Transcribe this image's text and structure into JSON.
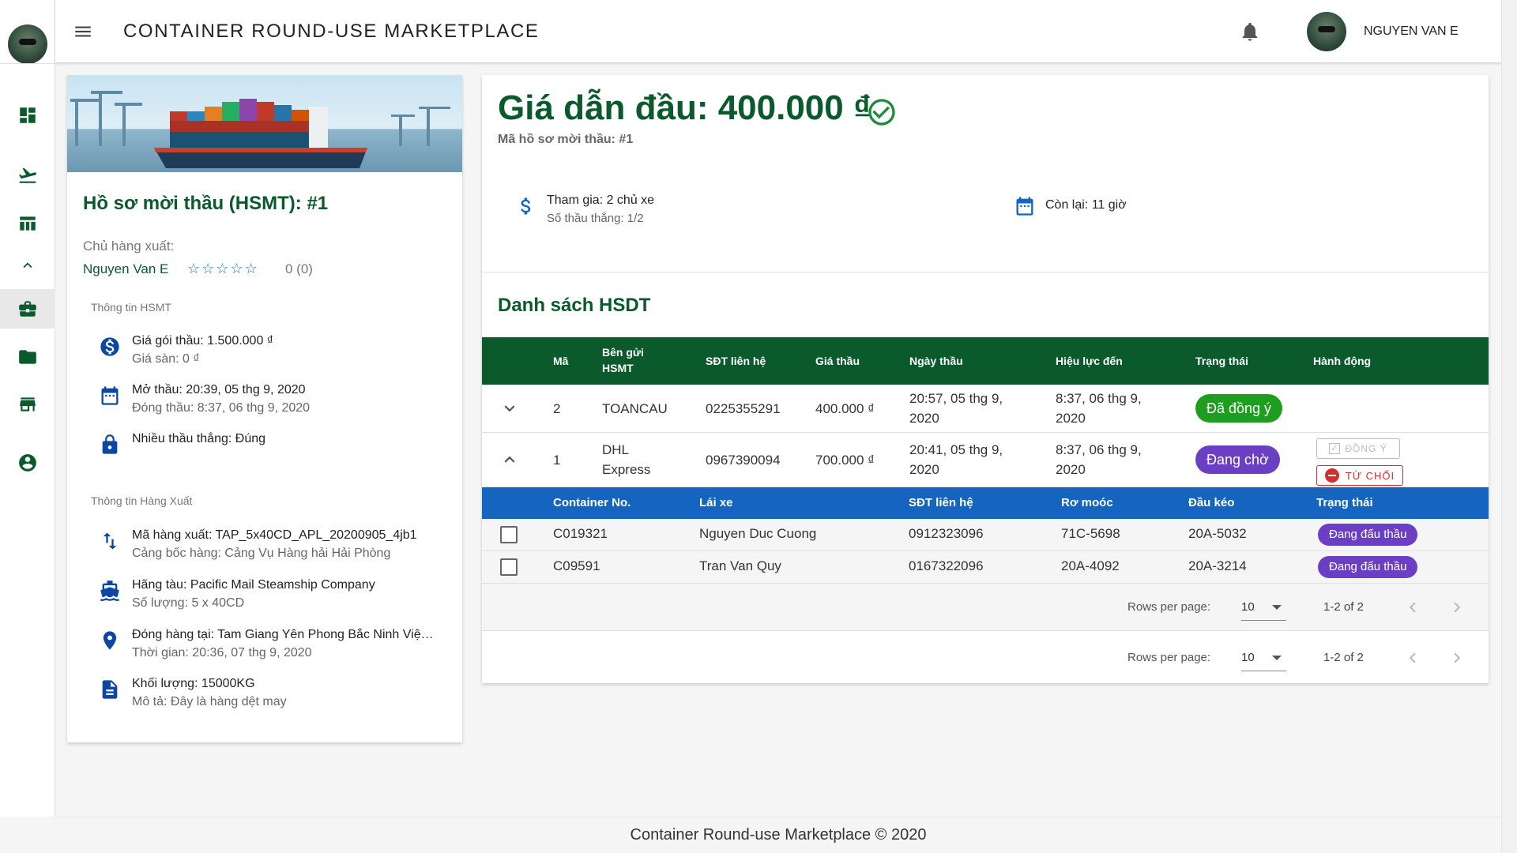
{
  "app": {
    "title": "CONTAINER ROUND-USE MARKETPLACE",
    "user_name": "NGUYEN VAN E",
    "footer": "Container Round-use Marketplace © 2020"
  },
  "sidebar": {
    "items": [
      {
        "icon": "dashboard-icon"
      },
      {
        "icon": "flight-takeoff-icon"
      },
      {
        "icon": "table-icon"
      },
      {
        "icon": "chevron-up-icon"
      },
      {
        "icon": "briefcase-icon",
        "active": true
      },
      {
        "icon": "folder-icon"
      },
      {
        "icon": "store-icon"
      },
      {
        "icon": "account-circle-icon"
      }
    ]
  },
  "tender": {
    "title": "Hồ sơ mời thầu (HSMT): #1",
    "owner_label": "Chủ hàng xuất:",
    "owner_name": "Nguyen Van E",
    "rating_stars": "☆☆☆☆☆",
    "rating_text": "0 (0)",
    "section_hsmt": "Thông tin HSMT",
    "price_line": "Giá gói thầu: 1.500.000 ₫",
    "floor_line": "Giá sàn: 0 ₫",
    "open_line": "Mở thầu: 20:39, 05 thg 9, 2020",
    "close_line": "Đóng thầu: 8:37, 06 thg 9, 2020",
    "multi_line": "Nhiều thầu thắng: Đúng",
    "section_goods": "Thông tin Hàng Xuất",
    "code_line": "Mã hàng xuất: TAP_5x40CD_APL_20200905_4jb1",
    "port_line": "Cảng bốc hàng: Cảng Vụ Hàng hải Hải Phòng",
    "shipline_line": "Hãng tàu: Pacific Mail Steamship Company",
    "qty_line": "Số lượng: 5 x 40CD",
    "pack_line": "Đóng hàng tại: Tam Giang Yên Phong Bắc Ninh Việ…",
    "time_line": "Thời gian: 20:36, 07 thg 9, 2020",
    "weight_line": "Khối lượng: 15000KG",
    "desc_line": "Mô tả: Đây là hàng dệt may"
  },
  "main": {
    "lead_price": "Giá dẫn đầu: 400.000 ₫",
    "lead_sub": "Mã hồ sơ mời thầu: #1",
    "participants": "Tham gia: 2 chủ xe",
    "winners": "Số thầu thắng: 1/2",
    "remaining": "Còn lại: 11 giờ",
    "list_title": "Danh sách HSDT",
    "columns": [
      "Mã",
      "Bên gửi HSMT",
      "SĐT liên hệ",
      "Giá thầu",
      "Ngày thầu",
      "Hiệu lực đến",
      "Trạng thái",
      "Hành động"
    ],
    "rows": [
      {
        "id": "2",
        "sender": "TOANCAU",
        "phone": "0225355291",
        "price": "400.000 ₫",
        "date": "20:57, 05 thg 9, 2020",
        "valid": "8:37, 06 thg 9, 2020",
        "status": "Đã đồng ý",
        "status_color": "#1e9e1e"
      },
      {
        "id": "1",
        "sender": "DHL Express",
        "phone": "0967390094",
        "price": "700.000 ₫",
        "date": "20:41, 05 thg 9, 2020",
        "valid": "8:37, 06 thg 9, 2020",
        "status": "Đang chờ",
        "status_color": "#6a3fc4",
        "action_agree": "ĐỒNG Ý",
        "action_reject": "TỪ CHỐI"
      }
    ],
    "sub_columns": [
      "Container No.",
      "Lái xe",
      "SĐT liên hệ",
      "Rơ moóc",
      "Đầu kéo",
      "Trạng thái"
    ],
    "sub_rows": [
      {
        "container": "C019321",
        "driver": "Nguyen Duc Cuong",
        "phone": "0912323096",
        "trailer": "71C-5698",
        "tractor": "20A-5032",
        "status": "Đang đấu thầu"
      },
      {
        "container": "C09591",
        "driver": "Tran Van Quy",
        "phone": "0167322096",
        "trailer": "20A-4092",
        "tractor": "20A-3214",
        "status": "Đang đấu thầu"
      }
    ],
    "pager": {
      "rows_per_page_label": "Rows per page:",
      "rows_per_page": "10",
      "range": "1-2 of 2"
    }
  },
  "colors": {
    "brand_green": "#0a5a2b",
    "blue": "#1565c0",
    "purple": "#6a3fc4",
    "green_chip": "#1e9e1e",
    "red": "#d32f2f"
  }
}
